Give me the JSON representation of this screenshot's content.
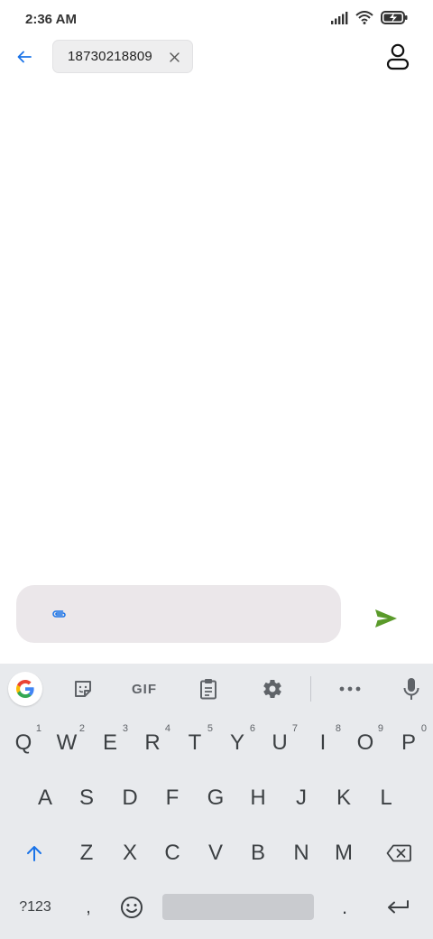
{
  "status_bar": {
    "time": "2:36 AM",
    "icons": [
      "signal-icon",
      "wifi-icon",
      "battery-charging-icon"
    ]
  },
  "header": {
    "back_icon": "arrow-left-icon",
    "recipient": "18730218809",
    "chip_close_icon": "close-icon",
    "contact_icon": "person-icon"
  },
  "compose": {
    "placeholder": "",
    "value": "",
    "attach_icon": "paperclip-icon",
    "send_icon": "send-icon"
  },
  "colors": {
    "accent_blue": "#1a73e8",
    "send_green": "#5a9a2a",
    "compose_bg": "#ebe7ea",
    "keyboard_bg": "#e8eaed",
    "key_text": "#3c4043"
  },
  "keyboard": {
    "toolbar": [
      {
        "name": "google-g-icon"
      },
      {
        "name": "sticker-icon"
      },
      {
        "name": "gif-button",
        "label": "GIF"
      },
      {
        "name": "clipboard-icon"
      },
      {
        "name": "gear-icon"
      },
      {
        "name": "more-icon"
      },
      {
        "name": "microphone-icon"
      }
    ],
    "row1": [
      {
        "key": "Q",
        "hint": "1"
      },
      {
        "key": "W",
        "hint": "2"
      },
      {
        "key": "E",
        "hint": "3"
      },
      {
        "key": "R",
        "hint": "4"
      },
      {
        "key": "T",
        "hint": "5"
      },
      {
        "key": "Y",
        "hint": "6"
      },
      {
        "key": "U",
        "hint": "7"
      },
      {
        "key": "I",
        "hint": "8"
      },
      {
        "key": "O",
        "hint": "9"
      },
      {
        "key": "P",
        "hint": "0"
      }
    ],
    "row2": [
      "A",
      "S",
      "D",
      "F",
      "G",
      "H",
      "J",
      "K",
      "L"
    ],
    "row3": [
      "Z",
      "X",
      "C",
      "V",
      "B",
      "N",
      "M"
    ],
    "bottom": {
      "symbols": "?123",
      "comma": ",",
      "period": "."
    }
  }
}
